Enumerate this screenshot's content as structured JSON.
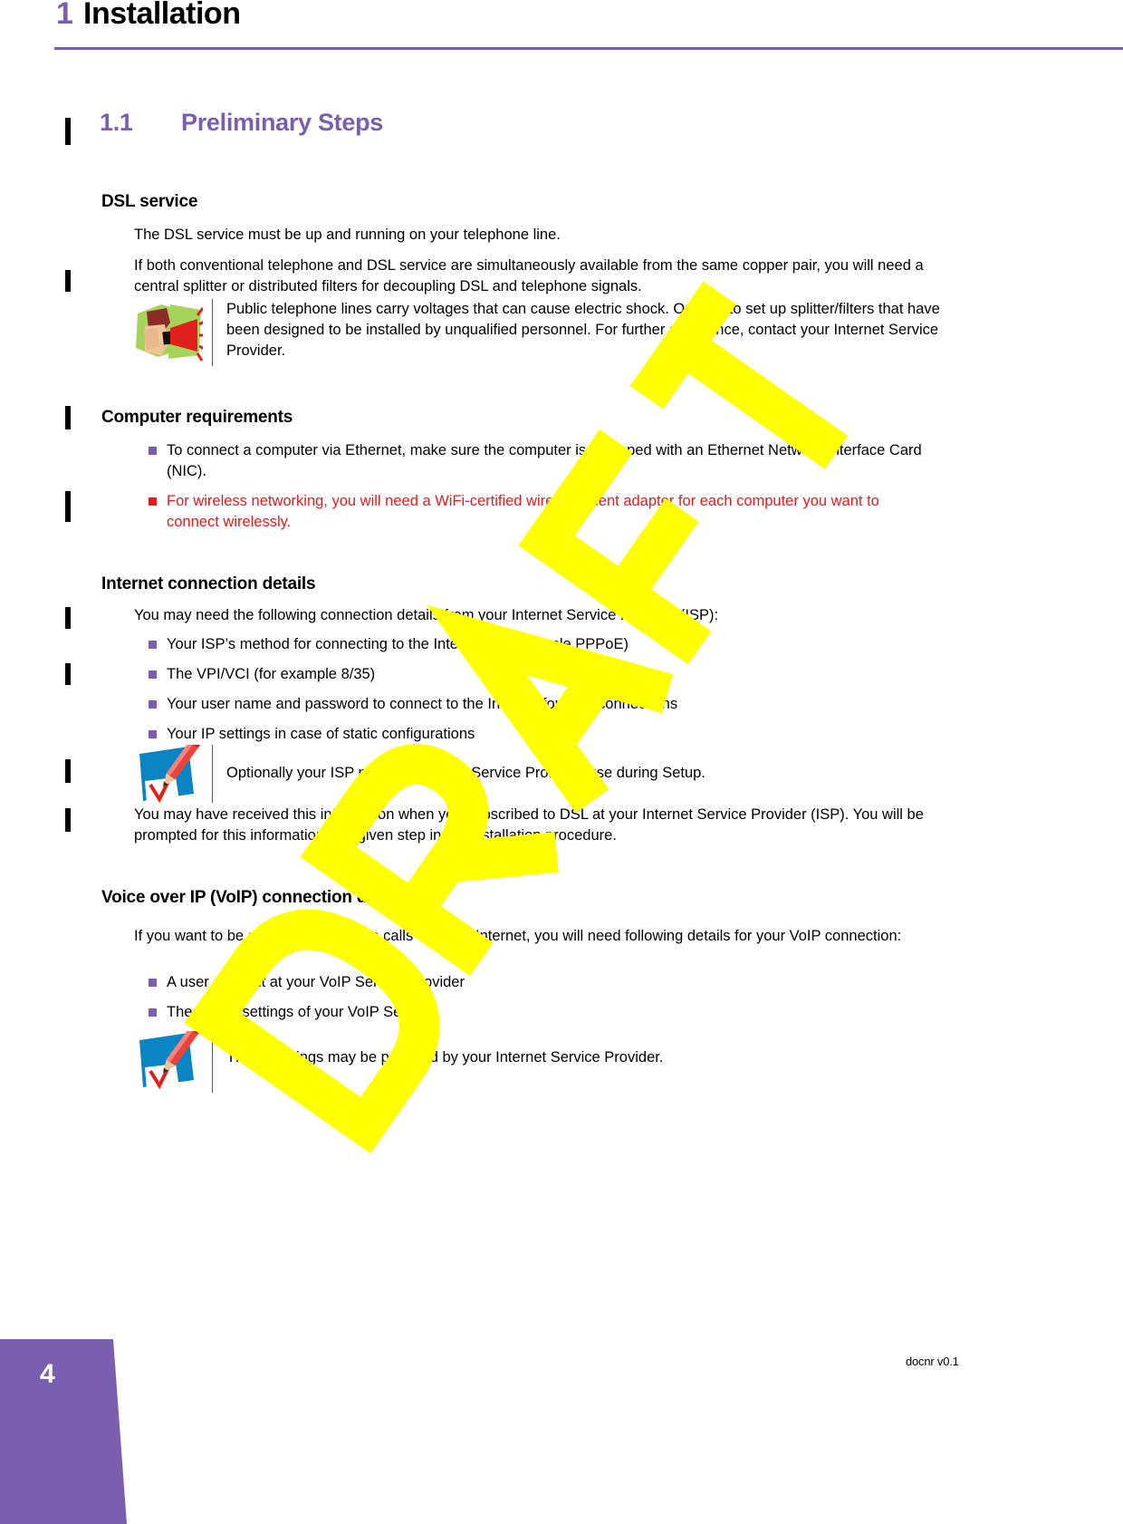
{
  "page": {
    "number": "4",
    "docnr": "docnr v0.1",
    "watermark_text": "DRAFT"
  },
  "colors": {
    "accent_purple": "#7a5fb0",
    "alert_red": "#e8191b",
    "watermark_yellow": "#ffff00",
    "note_blue": "#0b84c4",
    "warning_green": "#a6d45a"
  },
  "chapter": {
    "number": "1",
    "title": "Installation"
  },
  "section": {
    "number": "1.1",
    "title": "Preliminary Steps"
  },
  "dsl_service": {
    "heading": "DSL service",
    "para1": "The DSL service must be up and running on your telephone line.",
    "para2": "If both conventional telephone and DSL service are simultaneously available from the same copper pair, you will need a central splitter or distributed filters for decoupling DSL and telephone signals.",
    "warning": {
      "icon": "warning-megaphone-icon",
      "text": "Public telephone lines carry voltages that can cause electric shock. Only try to set up splitter/filters that have been designed to be installed by unqualified personnel. For further assistance, contact your Internet Service Provider."
    }
  },
  "computer_requirements": {
    "heading": "Computer requirements",
    "bullets": [
      {
        "text": "To connect a computer via Ethernet, make sure the computer is equipped with an Ethernet Network Interface Card (NIC).",
        "style": "normal"
      },
      {
        "text": "For wireless networking, you will need a WiFi-certified wireless client adapter for each computer you want to connect wirelessly.",
        "style": "red"
      }
    ]
  },
  "internet_connection": {
    "heading": "Internet connection details",
    "intro": "You may need the following connection details from your Internet Service Provider (ISP):",
    "bullets": [
      {
        "text": "Your ISP’s method for connecting to the Internet (for example PPPoE)"
      },
      {
        "text": "The VPI/VCI (for example 8/35)"
      },
      {
        "text": "Your user name and password to connect to the Internet for PPP connections"
      },
      {
        "text": "Your IP settings in case of static configurations"
      }
    ],
    "note": {
      "icon": "note-pencil-checklist-icon",
      "text": "Optionally your ISP may indicate the Service Profile to use during Setup."
    },
    "outro": "You may have received this information when you subscribed to DSL at your Internet Service Provider (ISP). You will be prompted for this information at a given step in the installation procedure."
  },
  "voip": {
    "heading": "Voice over IP (VoIP) connection details",
    "intro": "If you want to be able to make phone calls over the Internet, you will need following details for your VoIP connection:",
    "bullets": [
      {
        "text": "A user account at your VoIP Service Provider"
      },
      {
        "text": "The server settings of your VoIP Service"
      }
    ],
    "note": {
      "icon": "note-pencil-checklist-icon",
      "text": "These settings may be provided by your Internet Service Provider."
    }
  }
}
